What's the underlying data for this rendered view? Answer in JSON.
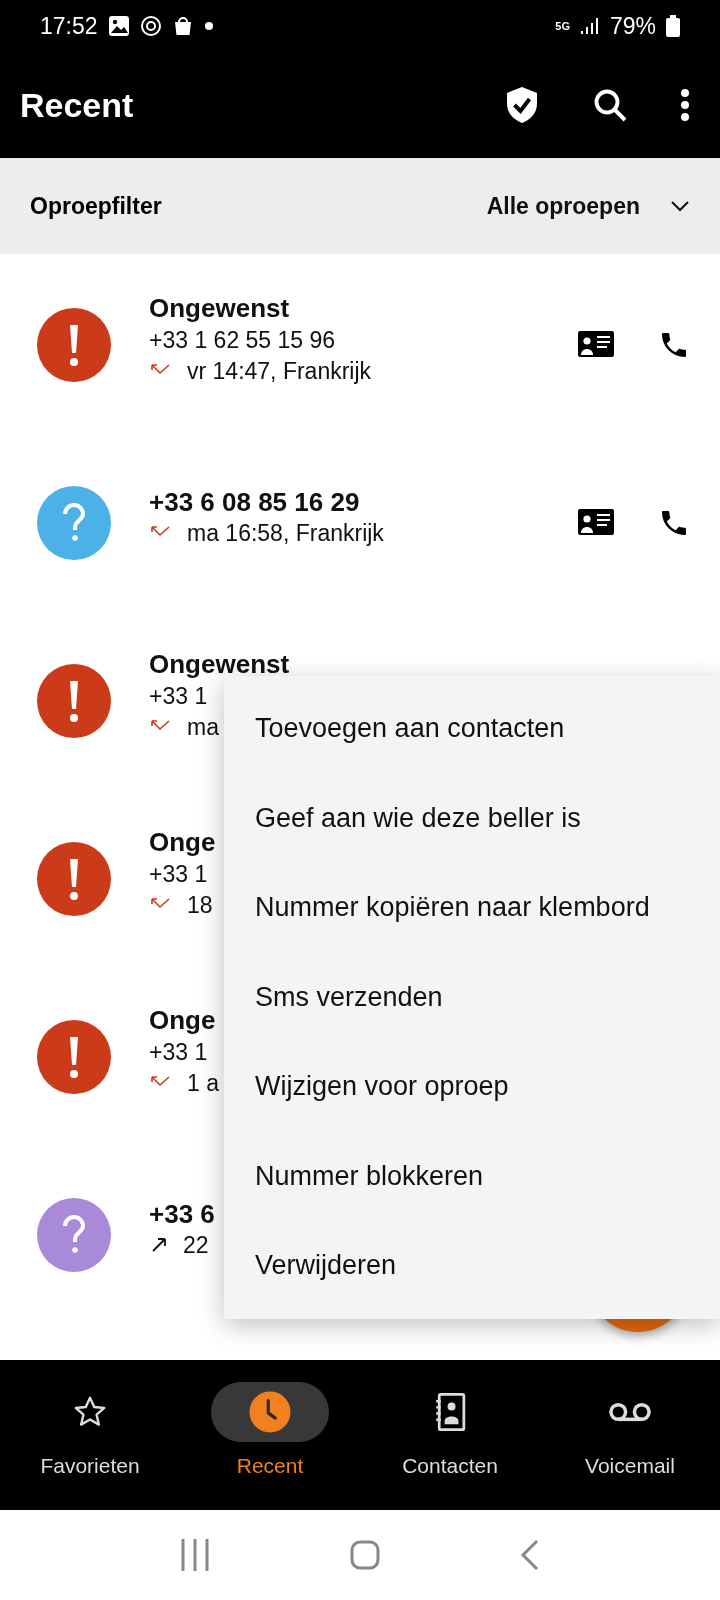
{
  "status_bar": {
    "time": "17:52",
    "network": "5G",
    "battery": "79%"
  },
  "app_bar": {
    "title": "Recent"
  },
  "filter": {
    "label": "Oproepfilter",
    "value": "Alle oproepen"
  },
  "calls": [
    {
      "avatar": {
        "kind": "spam",
        "color": "#cc3b19"
      },
      "title": "Ongewenst",
      "number": "+33 1 62 55 15 96",
      "meta": {
        "kind": "missed",
        "text": "vr 14:47, Frankrijk"
      },
      "actions": [
        {
          "kind": "contact_card"
        },
        {
          "kind": "call"
        }
      ]
    },
    {
      "avatar": {
        "kind": "unknown",
        "color": "#4cb1e6"
      },
      "title": "+33 6 08 85 16 29",
      "meta": {
        "kind": "missed",
        "text": "ma 16:58, Frankrijk"
      },
      "actions": [
        {
          "kind": "contact_card"
        },
        {
          "kind": "call"
        }
      ]
    },
    {
      "avatar": {
        "kind": "spam",
        "color": "#cc3b19"
      },
      "title": "Ongewenst",
      "number": "+33 1",
      "meta": {
        "kind": "missed",
        "text": "ma"
      }
    },
    {
      "avatar": {
        "kind": "spam",
        "color": "#cc3b19"
      },
      "title": "Onge",
      "number": "+33 1",
      "meta": {
        "kind": "missed",
        "text": "18"
      }
    },
    {
      "avatar": {
        "kind": "spam",
        "color": "#cc3b19"
      },
      "title": "Onge",
      "number": "+33 1",
      "meta": {
        "kind": "missed",
        "text": "1 a"
      }
    },
    {
      "avatar": {
        "kind": "unknown",
        "color": "#a98ad9"
      },
      "title": "+33 6",
      "meta": {
        "kind": "outgoing",
        "text": "22"
      }
    }
  ],
  "context_menu": [
    "Toevoegen aan contacten",
    "Geef aan wie deze beller is",
    "Nummer kopiëren naar klembord",
    "Sms verzenden",
    "Wijzigen voor oproep",
    "Nummer blokkeren",
    "Verwijderen"
  ],
  "bottom_nav": [
    {
      "label": "Favorieten",
      "selected": false
    },
    {
      "label": "Recent",
      "selected": true
    },
    {
      "label": "Contacten",
      "selected": false
    },
    {
      "label": "Voicemail",
      "selected": false
    }
  ]
}
